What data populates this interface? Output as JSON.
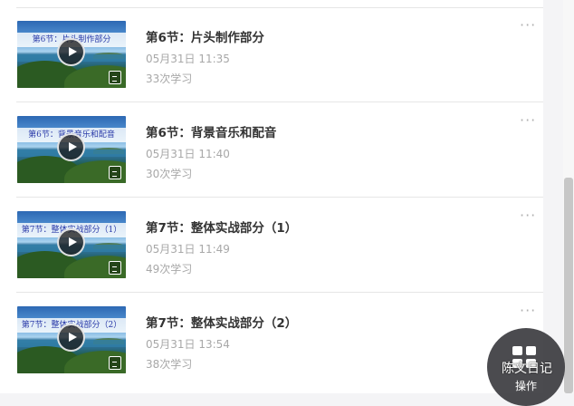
{
  "lessons": [
    {
      "thumb_title": "第6节：片头制作部分",
      "name": "第6节：片头制作部分",
      "date": "05月31日 11:35",
      "views": "33次学习"
    },
    {
      "thumb_title": "第6节：背景音乐和配音",
      "name": "第6节：背景音乐和配音",
      "date": "05月31日 11:40",
      "views": "30次学习"
    },
    {
      "thumb_title": "第7节：整体实战部分（1）",
      "name": "第7节：整体实战部分（1）",
      "date": "05月31日 11:49",
      "views": "49次学习"
    },
    {
      "thumb_title": "第7节：整体实战部分（2）",
      "name": "第7节：整体实战部分（2）",
      "date": "05月31日 13:54",
      "views": "38次学习"
    }
  ],
  "more_label": "···",
  "operate_button": {
    "label": "操作",
    "icon": "grid-icon"
  },
  "watermark": {
    "text": "陈文日记",
    "icon": "wechat-icon"
  }
}
